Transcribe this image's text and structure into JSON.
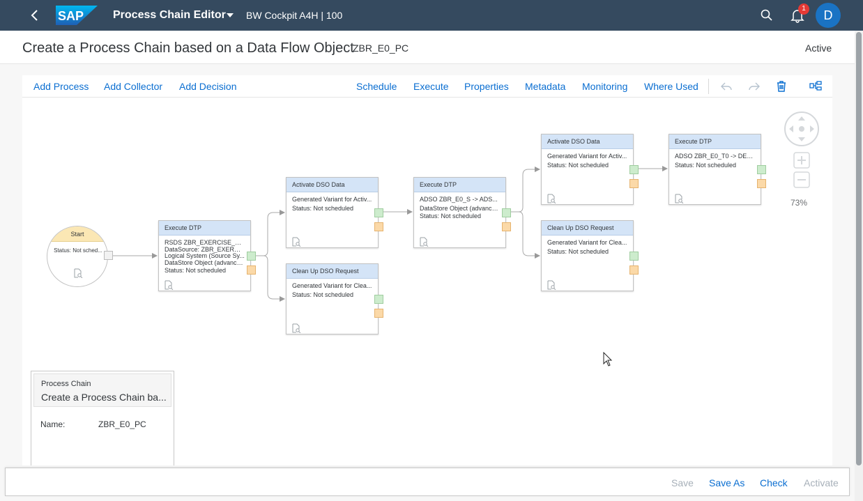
{
  "shell": {
    "app_title": "Process Chain Editor",
    "system": "BW Cockpit A4H | 100",
    "notification_count": "1",
    "avatar_initial": "D",
    "brand_text": "SAP"
  },
  "header": {
    "title": "Create a Process Chain based on a Data Flow Object",
    "chain_id": "ZBR_E0_PC",
    "status": "Active"
  },
  "toolbar": {
    "add_process": "Add Process",
    "add_collector": "Add Collector",
    "add_decision": "Add Decision",
    "schedule": "Schedule",
    "execute": "Execute",
    "properties": "Properties",
    "metadata": "Metadata",
    "monitoring": "Monitoring",
    "where_used": "Where Used"
  },
  "start_node": {
    "label": "Start",
    "status": "Status: Not sched..."
  },
  "nodes": [
    {
      "title": "Execute DTP",
      "lines": [
        "RSDS ZBR_EXERCISE_1 ...",
        "DataSource: ZBR_EXERCI...",
        "Logical System (Source Sy...",
        "DataStore Object (advance...",
        "Status: Not scheduled"
      ]
    },
    {
      "title": "Activate DSO Data",
      "lines": [
        "Generated Variant for Activ...",
        "Status: Not scheduled"
      ]
    },
    {
      "title": "Clean Up DSO Request",
      "lines": [
        "Generated Variant for Clea...",
        "Status: Not scheduled"
      ]
    },
    {
      "title": "Execute DTP",
      "lines": [
        "ADSO ZBR_E0_S -> ADS...",
        "DataStore Object (advance...",
        "Status: Not scheduled"
      ]
    },
    {
      "title": "Activate DSO Data",
      "lines": [
        "Generated Variant for Activ...",
        "Status: Not scheduled"
      ]
    },
    {
      "title": "Clean Up DSO Request",
      "lines": [
        "Generated Variant for Clea...",
        "Status: Not scheduled"
      ]
    },
    {
      "title": "Execute DTP",
      "lines": [
        "ADSO ZBR_E0_T0 -> DES...",
        "Status: Not scheduled"
      ]
    }
  ],
  "zoom_level": "73%",
  "details_panel": {
    "kind": "Process Chain",
    "name": "Create a Process Chain ba...",
    "field_label": "Name:",
    "field_value": "ZBR_E0_PC"
  },
  "footer": {
    "save": "Save",
    "save_as": "Save As",
    "check": "Check",
    "activate": "Activate"
  },
  "colors": {
    "shell_bg": "#354a5f",
    "link": "#0a6ed1",
    "node_header": "#d4e4f7",
    "port_ok": "#cdeccd",
    "port_error": "#fbd9a8",
    "start_header": "#fbe7b4"
  }
}
